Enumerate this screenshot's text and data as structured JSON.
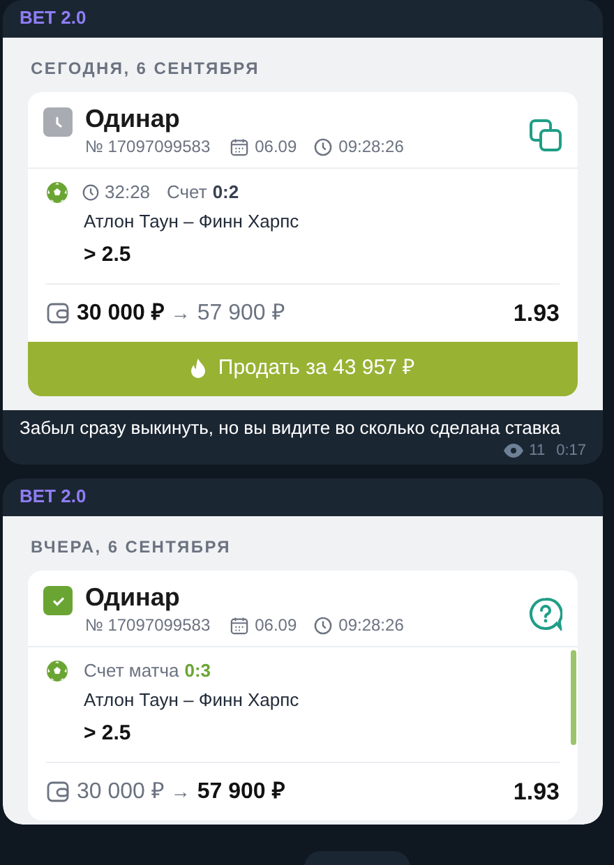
{
  "messages": [
    {
      "channel": "BET 2.0",
      "date_header": "СЕГОДНЯ, 6 СЕНТЯБРЯ",
      "bet": {
        "status_icon": {
          "kind": "pending"
        },
        "title": "Одинар",
        "number": "№ 17097099583",
        "date": "06.09",
        "time": "09:28:26",
        "action_icon": {
          "kind": "copy"
        },
        "timer": "32:28",
        "score_label": "Счет",
        "score": "0:2",
        "score_highlight": false,
        "teams": "Атлон Таун – Финн Харпс",
        "outcome": "> 2.5",
        "stake": "30 000 ₽",
        "arrow": "→",
        "payout": "57 900 ₽",
        "stake_emphasized": true,
        "odds": "1.93"
      },
      "sell_button": "Продать за 43 957 ₽",
      "caption": "Забыл сразу выкинуть, но вы видите во сколько сделана ставка",
      "views": "11",
      "time": "0:17"
    },
    {
      "channel": "BET 2.0",
      "date_header": "ВЧЕРА, 6 СЕНТЯБРЯ",
      "bet": {
        "status_icon": {
          "kind": "won"
        },
        "title": "Одинар",
        "number": "№ 17097099583",
        "date": "06.09",
        "time": "09:28:26",
        "action_icon": {
          "kind": "help"
        },
        "score_label": "Счет матча",
        "score": "0:3",
        "score_highlight": true,
        "teams": "Атлон Таун – Финн Харпс",
        "outcome": "> 2.5",
        "stake": "30 000 ₽",
        "arrow": "→",
        "payout": "57 900 ₽",
        "stake_emphasized": false,
        "odds": "1.93"
      }
    }
  ]
}
